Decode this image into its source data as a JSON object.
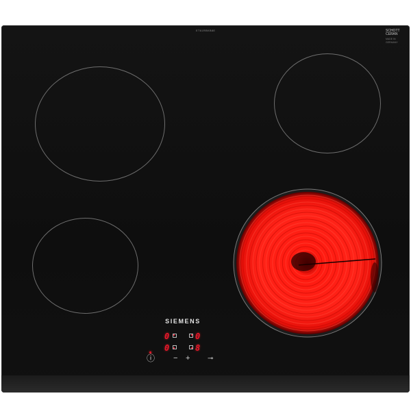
{
  "panel": {
    "model_code": "ET61RBKB8E",
    "glass_brand": "SCHOTT CERAN",
    "glass_small": "MADE IN GERMANY",
    "brand": "SIEMENS"
  },
  "colors": {
    "glass": "#111111",
    "ring": "#6e6e6e",
    "heat": "#ff2a2a",
    "display": "#e8162b"
  },
  "zones": [
    {
      "id": "front-left",
      "power_level": "0",
      "active": false
    },
    {
      "id": "rear-left",
      "power_level": "0",
      "active": false
    },
    {
      "id": "rear-right",
      "power_level": "0",
      "active": false
    },
    {
      "id": "front-right",
      "power_level": "8",
      "active": true
    }
  ],
  "controls": {
    "power": "ⓘ",
    "minus": "−",
    "plus": "+",
    "lock": "⊸"
  }
}
